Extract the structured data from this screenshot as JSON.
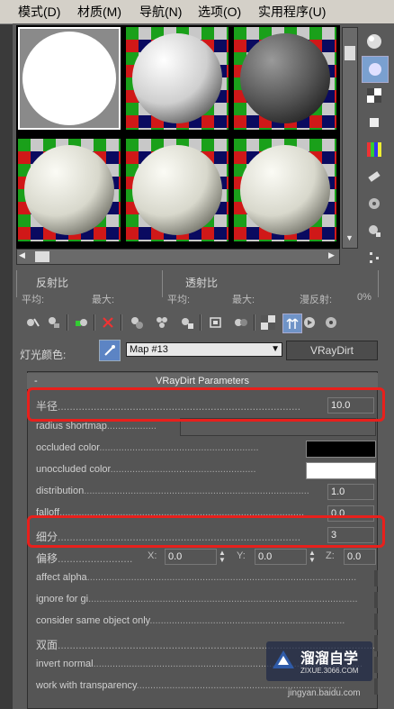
{
  "menubar": {
    "items": [
      {
        "label": "模式(D)"
      },
      {
        "label": "材质(M)"
      },
      {
        "label": "导航(N)"
      },
      {
        "label": "选项(O)"
      },
      {
        "label": "实用程序(U)"
      }
    ]
  },
  "stats": {
    "reflect_label": "反射比",
    "transmit_label": "透射比",
    "avg_label": "平均:",
    "max_label": "最大:",
    "avg2_label": "平均:",
    "max2_label": "最大:",
    "diffuse_label": "漫反射:",
    "diffuse_value": "0%"
  },
  "map": {
    "light_color_label": "灯光颜色:",
    "map_name": "Map #13",
    "map_type_button": "VRayDirt"
  },
  "rollout": {
    "title": "VRayDirt Parameters",
    "collapse_symbol": "-",
    "params": {
      "radius": {
        "label": "半径",
        "value": "10.0"
      },
      "radius_shortmap": {
        "label": "radius shortmap"
      },
      "occluded_color": {
        "label": "occluded color",
        "swatch": "#000000"
      },
      "unoccluded_color": {
        "label": "unoccluded color",
        "swatch": "#ffffff"
      },
      "distribution": {
        "label": "distribution",
        "value": "1.0"
      },
      "falloff": {
        "label": "falloff",
        "value": "0.0"
      },
      "subdivs": {
        "label": "细分",
        "value": "3"
      },
      "offset": {
        "label": "偏移",
        "x_label": "X:",
        "x_value": "0.0",
        "y_label": "Y:",
        "y_value": "0.0",
        "z_label": "Z:",
        "z_value": "0.0"
      },
      "affect_alpha": {
        "label": "affect alpha"
      },
      "ignore_for_gi": {
        "label": "ignore for gi"
      },
      "consider_same_object_only": {
        "label": "consider same object only"
      },
      "double_sided": {
        "label": "双面"
      },
      "invert_normal": {
        "label": "invert normal"
      },
      "work_with_transparency": {
        "label": "work with transparency"
      }
    }
  },
  "watermark": {
    "brand": "溜溜自学",
    "site": "ZIXUE.3066.COM",
    "source": "jingyan.baidu.com"
  }
}
